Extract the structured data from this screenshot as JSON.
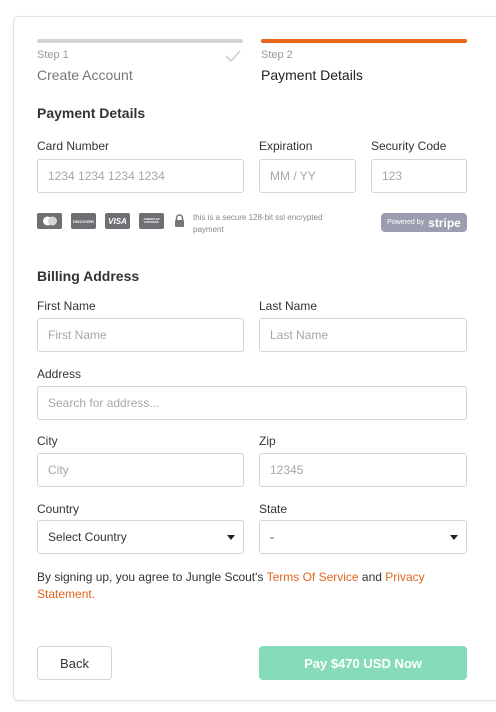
{
  "steps": [
    {
      "label": "Step 1",
      "title": "Create Account",
      "state": "completed"
    },
    {
      "label": "Step 2",
      "title": "Payment Details",
      "state": "active"
    }
  ],
  "colors": {
    "accent": "#e8651a",
    "done_bar": "#d4d4d4",
    "pay_button": "#86dbb9",
    "link": "#e0661f"
  },
  "payment": {
    "heading": "Payment Details",
    "card_number": {
      "label": "Card Number",
      "placeholder": "1234 1234 1234 1234"
    },
    "expiration": {
      "label": "Expiration",
      "placeholder": "MM / YY"
    },
    "security_code": {
      "label": "Security Code",
      "placeholder": "123"
    },
    "cards": [
      "MasterCard",
      "DISCOVER",
      "VISA",
      "AMERICAN EXPRESS"
    ],
    "secure_note": "this is a secure 128-bit ssl encrypted payment",
    "powered_by": "Powered by",
    "powered_brand": "stripe"
  },
  "billing": {
    "heading": "Billing Address",
    "first_name": {
      "label": "First Name",
      "placeholder": "First Name"
    },
    "last_name": {
      "label": "Last Name",
      "placeholder": "Last Name"
    },
    "address": {
      "label": "Address",
      "placeholder": "Search for address..."
    },
    "city": {
      "label": "City",
      "placeholder": "City"
    },
    "zip": {
      "label": "Zip",
      "placeholder": "12345"
    },
    "country": {
      "label": "Country",
      "value": "Select Country"
    },
    "state": {
      "label": "State",
      "value": "-"
    }
  },
  "terms": {
    "prefix": "By signing up, you agree to Jungle Scout's ",
    "terms_link": "Terms Of Service",
    "middle": " and ",
    "privacy_link": "Privacy Statement."
  },
  "actions": {
    "back": "Back",
    "pay": "Pay $470 USD Now"
  }
}
